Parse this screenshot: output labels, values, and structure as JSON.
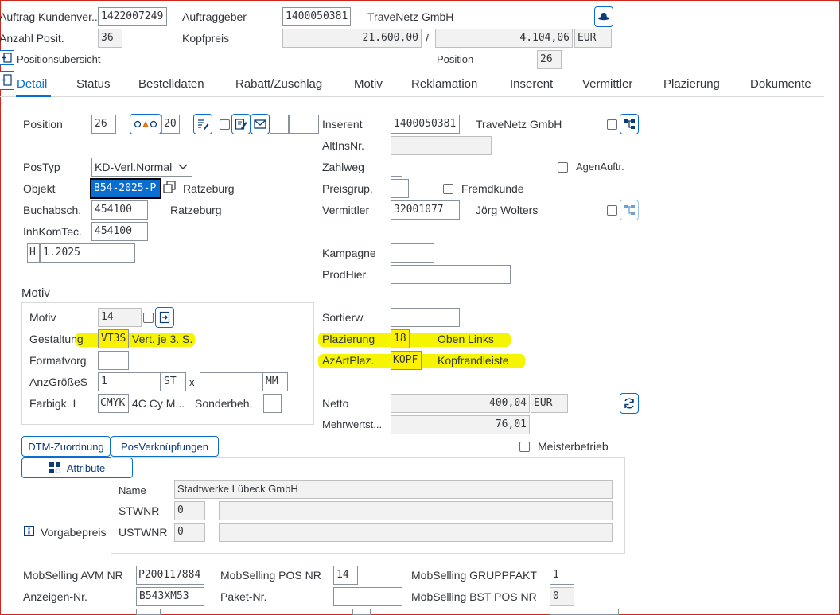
{
  "header": {
    "auftrag_label": "Auftrag Kundenver...",
    "auftrag_value": "1422007249",
    "auftraggeber_label": "Auftraggeber",
    "auftraggeber_value": "1400050381",
    "auftraggeber_name": "TraveNetz GmbH",
    "anzahl_label": "Anzahl Posit.",
    "anzahl_value": "36",
    "kopfpreis_label": "Kopfpreis",
    "kopfpreis_value": "21.600,00",
    "slash": "/",
    "kopfpreis_value2": "4.104,06",
    "currency": "EUR",
    "positionsuebersicht": "Positionsübersicht",
    "position_label": "Position",
    "position_value": "26"
  },
  "tabs": [
    {
      "label": "Detail",
      "active": true
    },
    {
      "label": "Status"
    },
    {
      "label": "Bestelldaten"
    },
    {
      "label": "Rabatt/Zuschlag"
    },
    {
      "label": "Motiv"
    },
    {
      "label": "Reklamation"
    },
    {
      "label": "Inserent"
    },
    {
      "label": "Vermittler"
    },
    {
      "label": "Plazierung"
    },
    {
      "label": "Dokumente"
    }
  ],
  "left": {
    "position_label": "Position",
    "position_value": "26",
    "sub_position_value": "20",
    "postyp_label": "PosTyp",
    "postyp_value": "KD-Verl.Normal",
    "objekt_label": "Objekt",
    "objekt_value": "B54-2025-P",
    "objekt_name": "Ratzeburg",
    "buchabsch_label": "Buchabsch.",
    "buchabsch_value": "454100",
    "buchabsch_name": "Ratzeburg",
    "inhkomtec_label": "InhKomTec.",
    "inhkomtec_value": "454100",
    "h_value": "H",
    "period_value": "1.2025"
  },
  "right": {
    "inserent_label": "Inserent",
    "inserent_value": "1400050381",
    "inserent_name": "TraveNetz GmbH",
    "altinsnr_label": "AltInsNr.",
    "zahlweg_label": "Zahlweg",
    "agenauftr_label": "AgenAuftr.",
    "preisgrup_label": "Preisgrup.",
    "fremdkunde_label": "Fremdkunde",
    "vermittler_label": "Vermittler",
    "vermittler_value": "32001077",
    "vermittler_name": "Jörg Wolters",
    "kampagne_label": "Kampagne",
    "prodhier_label": "ProdHier."
  },
  "motiv": {
    "title": "Motiv",
    "motiv_label": "Motiv",
    "motiv_value": "14",
    "gestaltung_label": "Gestaltung",
    "gestaltung_value": "VT3S",
    "gestaltung_text": "Vert. je 3. S.",
    "formatvorg_label": "Formatvorg",
    "anzgroesse_label": "AnzGrößeS",
    "anzgroesse_value": "1",
    "anzgroesse_unit": "ST",
    "x_label": "x",
    "mm_unit": "MM",
    "farbigk_label": "Farbigk. I",
    "farbigk_value": "CMYK",
    "farbigk_text": "4C Cy M...",
    "sonderbeh_label": "Sonderbeh."
  },
  "placement": {
    "sortierw_label": "Sortierw.",
    "plazierung_label": "Plazierung",
    "plazierung_value": "18",
    "plazierung_text": "Oben Links",
    "azartplaz_label": "AzArtPlaz.",
    "azartplaz_value": "KOPF",
    "azartplaz_text": "Kopfrandleiste",
    "netto_label": "Netto",
    "netto_value": "400,04",
    "netto_currency": "EUR",
    "mwst_label": "Mehrwertst...",
    "mwst_value": "76,01",
    "meisterbetrieb_label": "Meisterbetrieb"
  },
  "buttons": {
    "dtm": "DTM-Zuordnung",
    "posverk": "PosVerknüpfungen",
    "attribute": "Attribute"
  },
  "address": {
    "vorgabepreis_label": "Vorgabepreis",
    "name_label": "Name",
    "name_value": "Stadtwerke Lübeck GmbH",
    "stwnr_label": "STWNR",
    "stwnr_value": "0",
    "ustwnr_label": "USTWNR",
    "ustwnr_value": "0"
  },
  "mobselling": {
    "avm_label": "MobSelling AVM NR",
    "avm_value": "P200117884",
    "pos_label": "MobSelling POS NR",
    "pos_value": "14",
    "gruppfakt_label": "MobSelling GRUPPFAKT",
    "gruppfakt_value": "1",
    "anzeigen_label": "Anzeigen-Nr.",
    "anzeigen_value": "B543XM53",
    "paket_label": "Paket-Nr.",
    "bstpos_label": "MobSelling BST POS NR",
    "bstpos_value": "0"
  },
  "colors": {
    "accent": "#0a6ed1",
    "highlight": "#f5f500",
    "frame": "#d0271d"
  }
}
